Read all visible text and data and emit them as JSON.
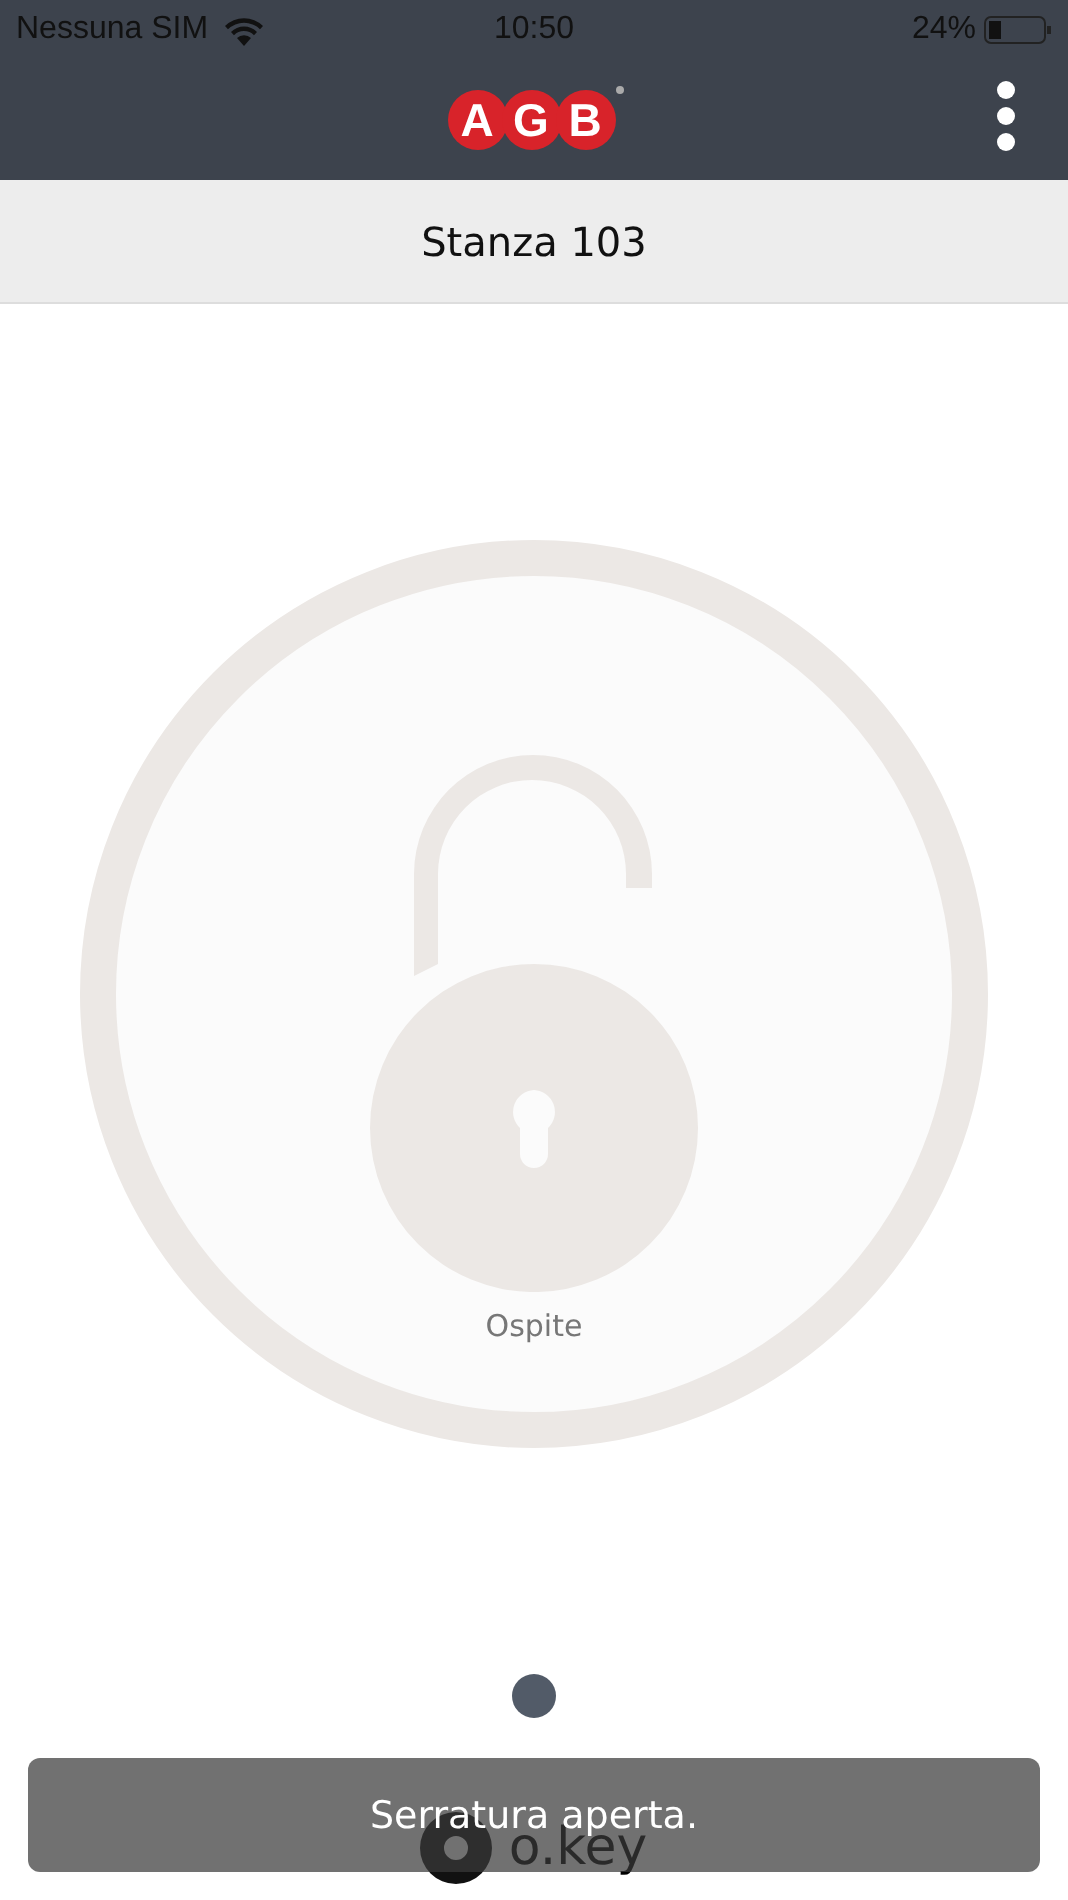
{
  "status_bar": {
    "carrier": "Nessuna SIM",
    "time": "10:50",
    "battery": "24%"
  },
  "header": {
    "logo_letters": [
      "A",
      "G",
      "B"
    ]
  },
  "room": {
    "title": "Stanza 103"
  },
  "lock": {
    "open": true,
    "label": "Ospite"
  },
  "pager": [
    {
      "selected": true
    }
  ],
  "footer": {
    "brand": "o.key"
  },
  "toast": {
    "message": "Serratura aperta."
  }
}
